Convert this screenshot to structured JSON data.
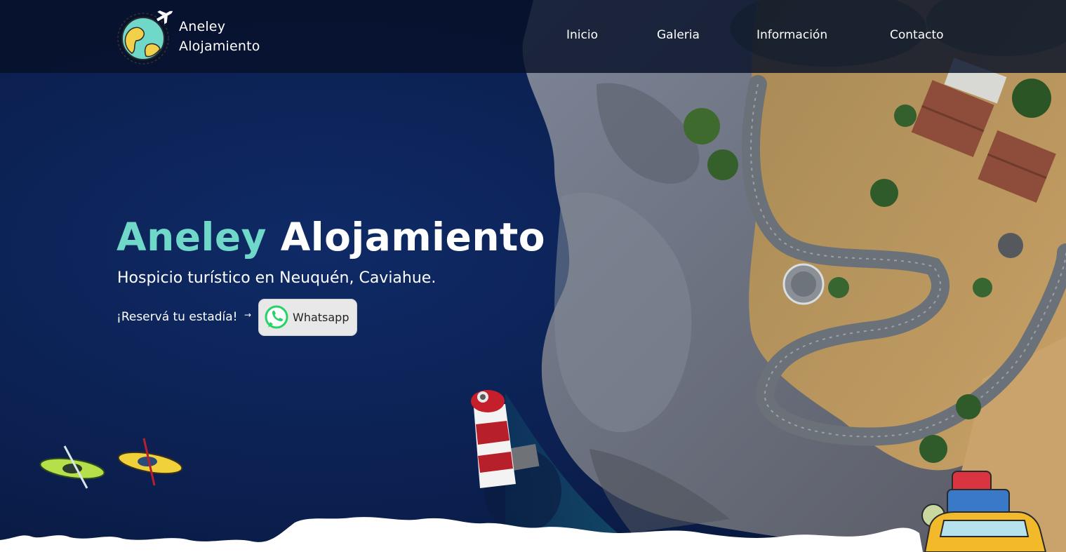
{
  "brand": {
    "line1": "Aneley",
    "line2": "Alojamiento"
  },
  "nav": {
    "items": [
      {
        "label": "Inicio"
      },
      {
        "label": "Galeria"
      },
      {
        "label": "Información"
      },
      {
        "label": "Contacto"
      }
    ]
  },
  "hero": {
    "title_accent": "Aneley",
    "title_main": "Alojamiento",
    "subtitle": "Hospicio turístico en Neuquén, Caviahue.",
    "cta_text": "¡Reservá tu estadía!",
    "cta_arrow": "→",
    "whatsapp_label": "Whatsapp"
  },
  "colors": {
    "navbar_bg": "#061028",
    "ocean": "#0b1d44",
    "title_accent": "#6fd8c9",
    "whatsapp_green": "#25d366",
    "button_bg": "#e8e8e8"
  },
  "icons": [
    "globe-plane-logo-icon",
    "whatsapp-icon",
    "kayak-illustration",
    "lighthouse-illustration",
    "car-luggage-illustration"
  ]
}
